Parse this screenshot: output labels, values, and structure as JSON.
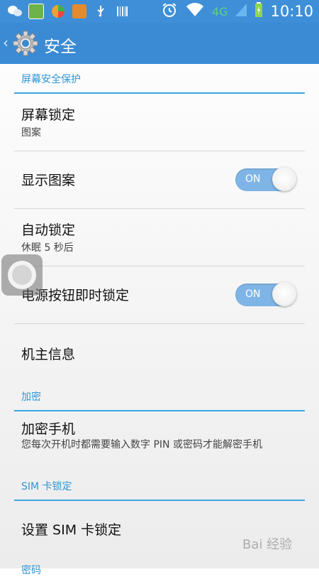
{
  "status_bar": {
    "network": "4G",
    "time": "10:10",
    "icons": [
      "wechat-icon",
      "app-icon",
      "browser-icon",
      "tools-icon",
      "usb-icon",
      "barcode-icon",
      "alarm-icon",
      "wifi-icon",
      "signal-icon",
      "battery-icon"
    ]
  },
  "action_bar": {
    "back_glyph": "‹",
    "title": "安全"
  },
  "sections": {
    "screen_protection": {
      "header": "屏幕安全保护",
      "screen_lock": {
        "title": "屏幕锁定",
        "summary": "图案"
      },
      "show_pattern": {
        "title": "显示图案",
        "toggle": "ON"
      },
      "auto_lock": {
        "title": "自动锁定",
        "summary": "休眠 5 秒后"
      },
      "power_lock": {
        "title": "电源按钮即时锁定",
        "toggle": "ON"
      },
      "owner_info": {
        "title": "机主信息"
      }
    },
    "encryption": {
      "header": "加密",
      "encrypt_phone": {
        "title": "加密手机",
        "summary": "您每次开机时都需要输入数字 PIN 或密码才能解密手机"
      }
    },
    "sim_lock": {
      "header": "SIM 卡锁定",
      "set_sim_lock": {
        "title": "设置 SIM 卡锁定"
      }
    },
    "next_partial": {
      "header": "密码"
    }
  },
  "watermark": "Bai 经验",
  "colors": {
    "status_bar": "#3e8fd8",
    "action_bar": "#3a8ad4",
    "accent": "#2d96d6",
    "toggle_on": "#7fb5e6"
  }
}
